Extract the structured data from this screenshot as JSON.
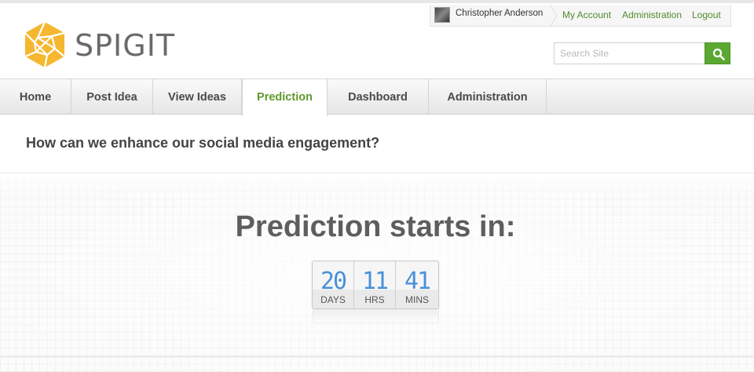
{
  "brand": {
    "name": "SPIGIT"
  },
  "user_bar": {
    "username": "Christopher Anderson",
    "my_account": "My Account",
    "administration": "Administration",
    "logout": "Logout"
  },
  "search": {
    "placeholder": "Search Site",
    "value": ""
  },
  "nav": {
    "items": [
      {
        "label": "Home"
      },
      {
        "label": "Post Idea"
      },
      {
        "label": "View Ideas"
      },
      {
        "label": "Prediction",
        "active": true
      },
      {
        "label": "Dashboard"
      },
      {
        "label": "Administration"
      }
    ]
  },
  "question": "How can we enhance our social media engagement?",
  "prediction": {
    "title": "Prediction starts in:",
    "countdown": {
      "days": "20",
      "days_label": "DAYS",
      "hrs": "11",
      "hrs_label": "HRS",
      "mins": "41",
      "mins_label": "MINS"
    }
  },
  "colors": {
    "accent_green": "#5aa832",
    "logo_yellow": "#f5b730",
    "countdown_blue": "#4a90d9"
  }
}
